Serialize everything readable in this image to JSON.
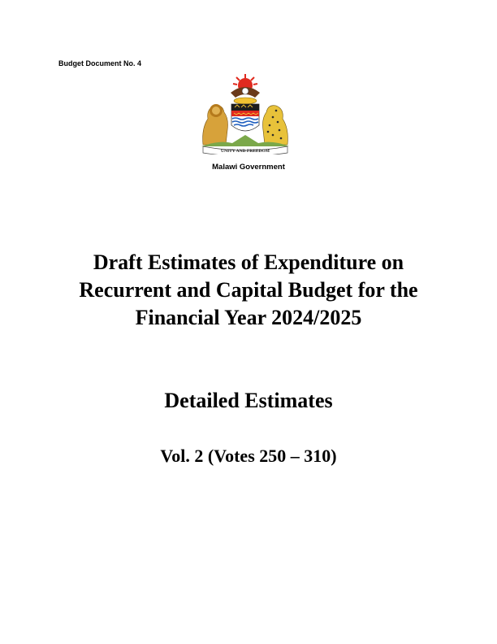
{
  "document_number": "Budget Document No. 4",
  "emblem": {
    "name": "malawi-coat-of-arms",
    "motto": "UNITY AND FREEDOM"
  },
  "issuer": "Malawi Government",
  "title_lines": [
    "Draft Estimates of Expenditure on",
    "Recurrent and Capital Budget for the",
    "Financial Year 2024/2025"
  ],
  "subtitle": "Detailed Estimates",
  "volume": "Vol. 2 (Votes 250 – 310)"
}
